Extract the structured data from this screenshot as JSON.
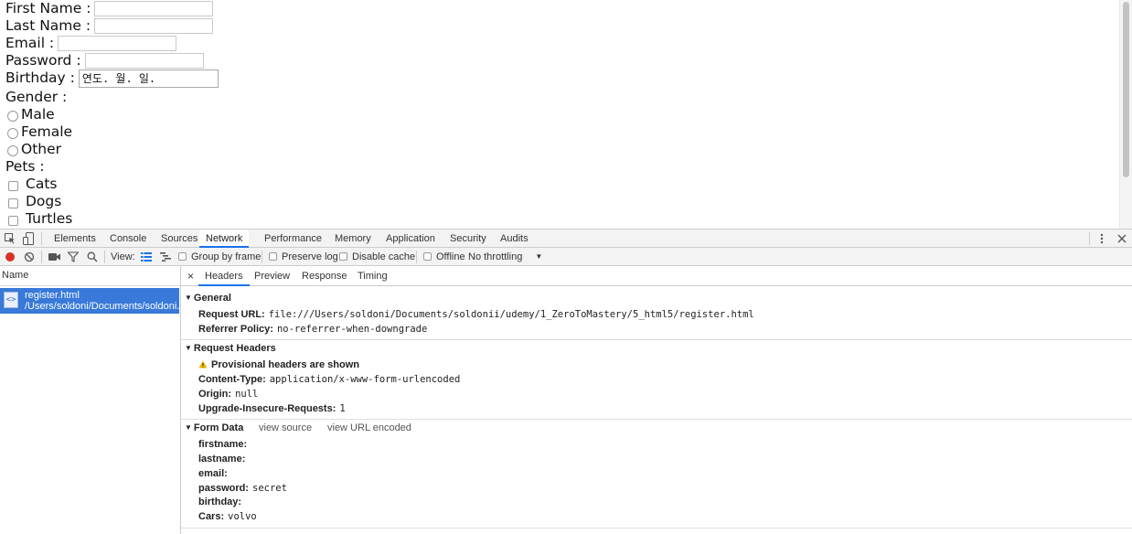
{
  "form": {
    "first_name_label": "First Name :",
    "last_name_label": "Last Name :",
    "email_label": "Email :",
    "password_label": "Password :",
    "birthday_label": "Birthday :",
    "birthday_placeholder": "연도. 월. 일.",
    "gender_label": "Gender :",
    "gender_options": [
      "Male",
      "Female",
      "Other"
    ],
    "pets_label": "Pets :",
    "pet_options": [
      "Cats",
      "Dogs",
      "Turtles"
    ]
  },
  "devtools": {
    "tabs": [
      "Elements",
      "Console",
      "Sources",
      "Network",
      "Performance",
      "Memory",
      "Application",
      "Security",
      "Audits"
    ],
    "active_tab": "Network",
    "toolbar": {
      "view_label": "View:",
      "group_by_frame": "Group by frame",
      "preserve_log": "Preserve log",
      "disable_cache": "Disable cache",
      "offline": "Offline",
      "throttling": "No throttling"
    },
    "name_column": "Name",
    "request": {
      "name": "register.html",
      "path": "/Users/soldoni/Documents/soldoni..."
    },
    "detail_tabs": [
      "Headers",
      "Preview",
      "Response",
      "Timing"
    ],
    "close_symbol": "×",
    "general": {
      "title": "General",
      "request_url_key": "Request URL:",
      "request_url": "file:///Users/soldoni/Documents/soldonii/udemy/1_ZeroToMastery/5_html5/register.html",
      "referrer_policy_key": "Referrer Policy:",
      "referrer_policy": "no-referrer-when-downgrade"
    },
    "request_headers": {
      "title": "Request Headers",
      "warning": "Provisional headers are shown",
      "content_type_key": "Content-Type:",
      "content_type": "application/x-www-form-urlencoded",
      "origin_key": "Origin:",
      "origin": "null",
      "upgrade_key": "Upgrade-Insecure-Requests:",
      "upgrade": "1"
    },
    "form_data": {
      "title": "Form Data",
      "view_source": "view source",
      "view_url_encoded": "view URL encoded",
      "fields": [
        {
          "key": "firstname:",
          "value": ""
        },
        {
          "key": "lastname:",
          "value": ""
        },
        {
          "key": "email:",
          "value": ""
        },
        {
          "key": "password:",
          "value": "secret"
        },
        {
          "key": "birthday:",
          "value": ""
        },
        {
          "key": "Cars:",
          "value": "volvo"
        }
      ]
    },
    "colors": {
      "accent": "#1a73e8",
      "selected_row": "#3879d9",
      "record": "#d93025"
    }
  }
}
